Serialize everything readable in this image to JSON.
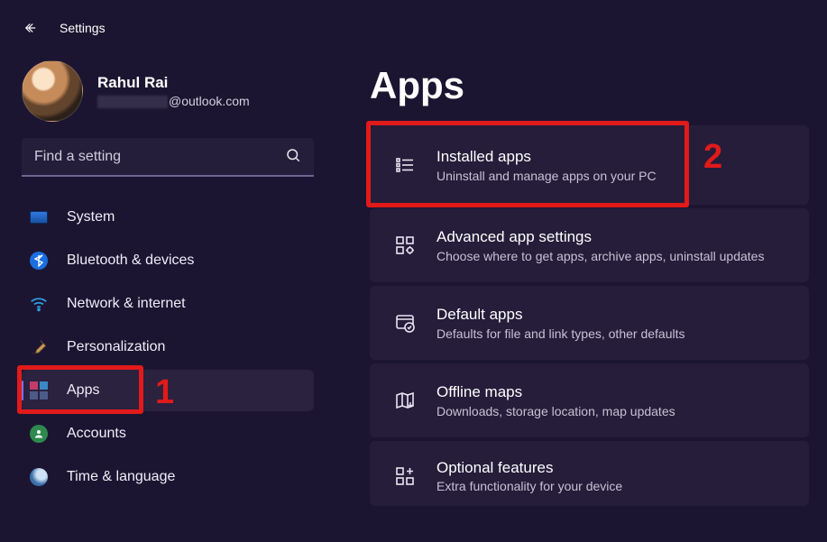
{
  "window": {
    "title": "Settings"
  },
  "profile": {
    "name": "Rahul Rai",
    "email_suffix": "@outlook.com"
  },
  "search": {
    "placeholder": "Find a setting"
  },
  "sidebar": {
    "items": [
      {
        "label": "System"
      },
      {
        "label": "Bluetooth & devices"
      },
      {
        "label": "Network & internet"
      },
      {
        "label": "Personalization"
      },
      {
        "label": "Apps"
      },
      {
        "label": "Accounts"
      },
      {
        "label": "Time & language"
      }
    ],
    "selected_index": 4
  },
  "page": {
    "title": "Apps"
  },
  "cards": [
    {
      "title": "Installed apps",
      "sub": "Uninstall and manage apps on your PC"
    },
    {
      "title": "Advanced app settings",
      "sub": "Choose where to get apps, archive apps, uninstall updates"
    },
    {
      "title": "Default apps",
      "sub": "Defaults for file and link types, other defaults"
    },
    {
      "title": "Offline maps",
      "sub": "Downloads, storage location, map updates"
    },
    {
      "title": "Optional features",
      "sub": "Extra functionality for your device"
    }
  ],
  "annotations": {
    "one": "1",
    "two": "2"
  }
}
